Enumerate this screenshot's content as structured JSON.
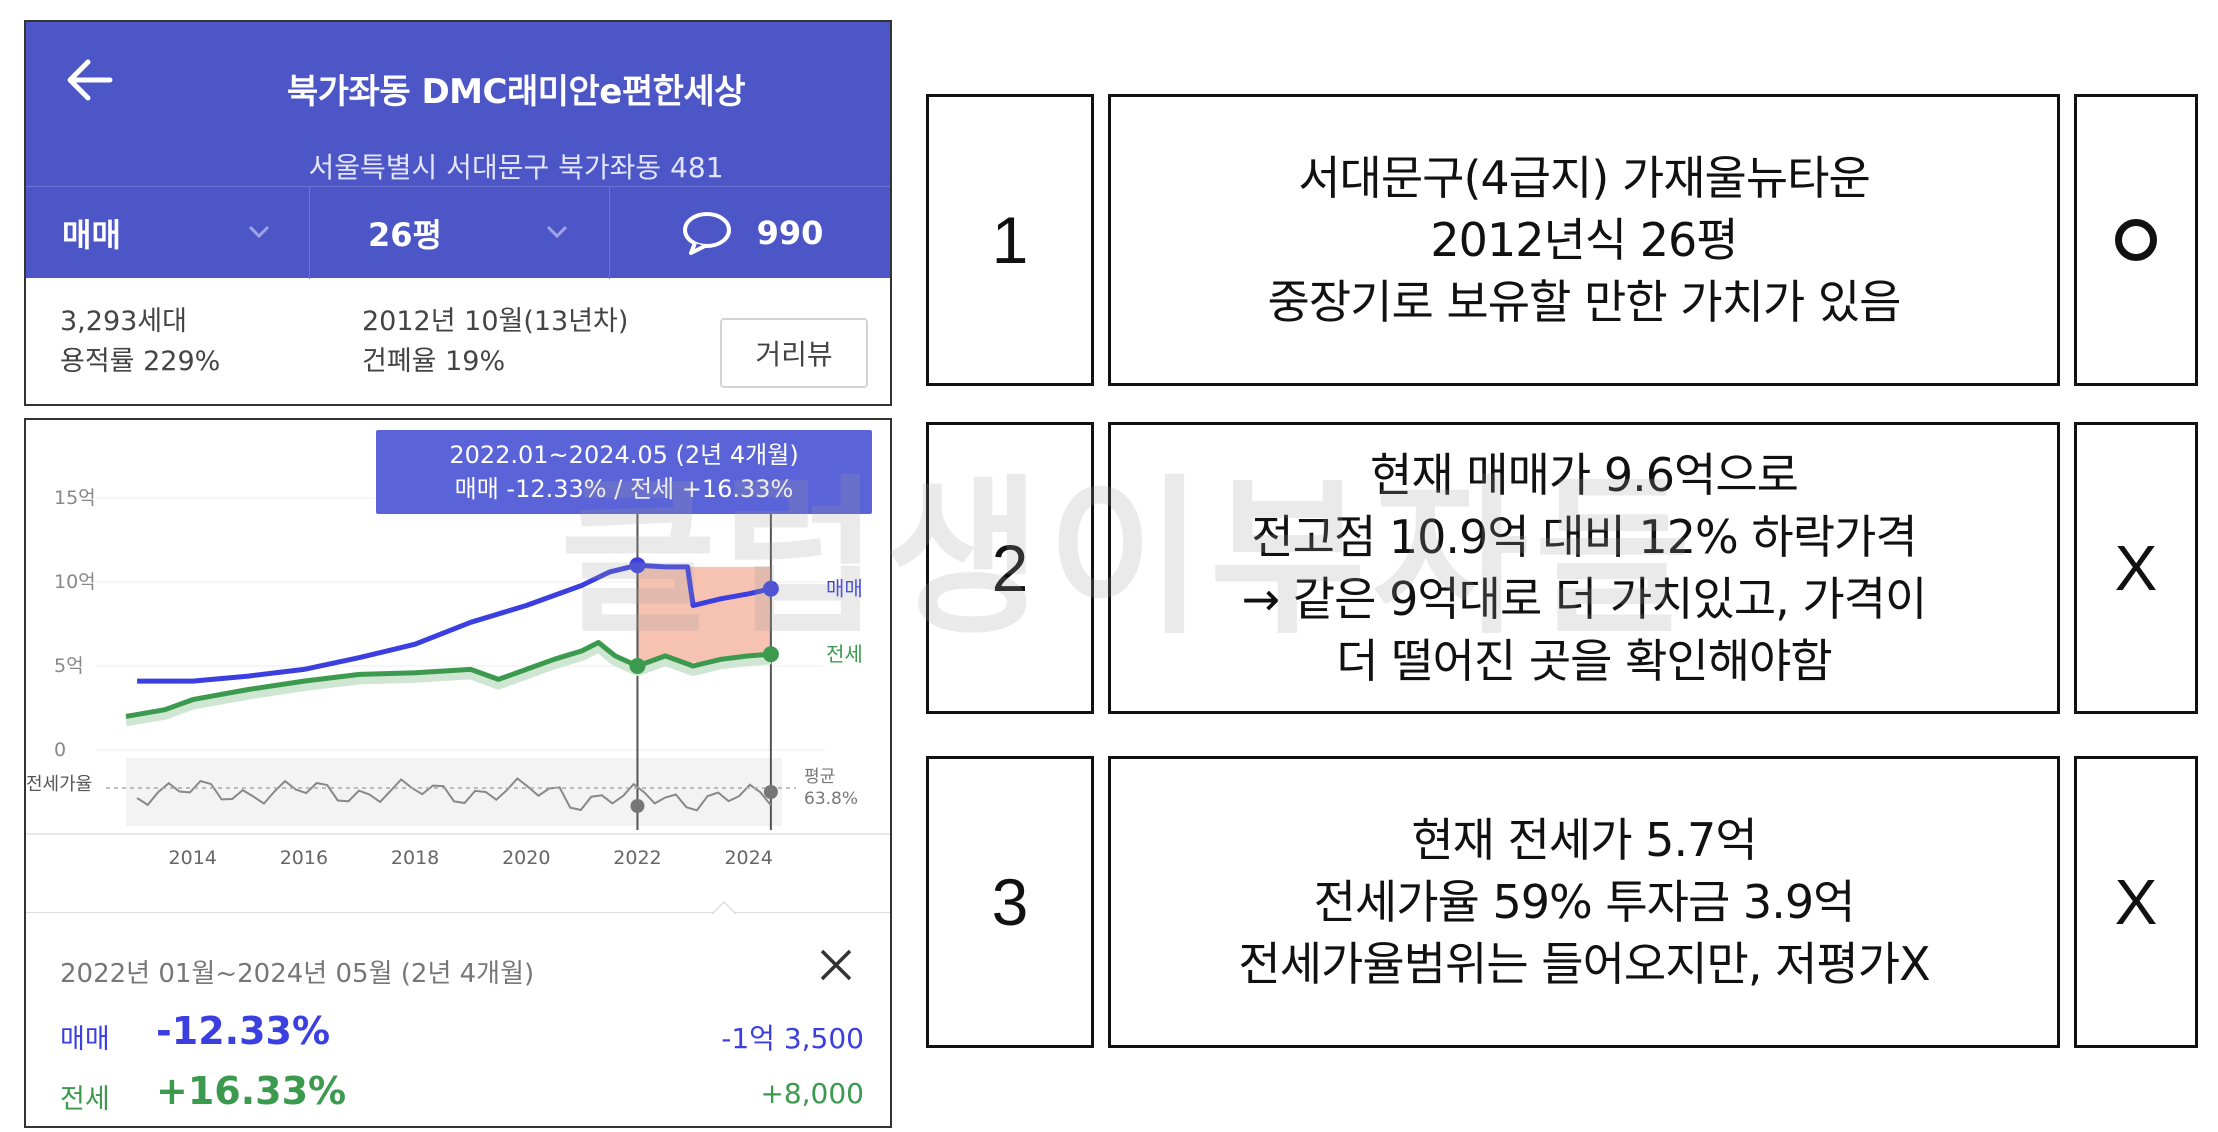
{
  "header": {
    "title": "북가좌동 DMC래미안e편한세상",
    "address": "서울특별시 서대문구 북가좌동 481",
    "trade_type": "매매",
    "size": "26평",
    "comment_count": "990"
  },
  "info": {
    "households": "3,293세대",
    "floor_area_ratio": "용적률 229%",
    "built": "2012년 10월(13년차)",
    "coverage_ratio": "건폐율 19%",
    "street_view_button": "거리뷰"
  },
  "chart": {
    "tooltip_line1": "2022.01~2024.05 (2년 4개월)",
    "tooltip_line2": "매매 -12.33%  /  전세 +16.33%",
    "y_ticks": [
      "15억",
      "10억",
      "5억",
      "0"
    ],
    "ratio_label": "전세가율",
    "avg_label": "평균",
    "avg_value": "63.8%",
    "x_ticks": [
      "2014",
      "2016",
      "2018",
      "2020",
      "2022",
      "2024"
    ],
    "series_sale_label": "매매",
    "series_jeonse_label": "전세",
    "colors": {
      "sale": "#3b3fe0",
      "jeonse": "#3b9a4e",
      "ratio": "#888888",
      "highlight": "#f5b9a4"
    }
  },
  "chart_data": {
    "type": "line",
    "xlabel": "",
    "ylabel": "",
    "ylim": [
      0,
      15
    ],
    "x_range": [
      2012.8,
      2024.6
    ],
    "series": [
      {
        "name": "매매",
        "points": [
          [
            2013.0,
            4.1
          ],
          [
            2014.0,
            4.1
          ],
          [
            2015.0,
            4.4
          ],
          [
            2016.0,
            4.8
          ],
          [
            2017.0,
            5.5
          ],
          [
            2018.0,
            6.3
          ],
          [
            2019.0,
            7.6
          ],
          [
            2020.0,
            8.6
          ],
          [
            2021.0,
            9.8
          ],
          [
            2021.5,
            10.6
          ],
          [
            2022.0,
            11.0
          ],
          [
            2022.5,
            10.9
          ],
          [
            2022.9,
            10.9
          ],
          [
            2023.0,
            8.6
          ],
          [
            2023.5,
            9.0
          ],
          [
            2024.0,
            9.3
          ],
          [
            2024.4,
            9.6
          ]
        ]
      },
      {
        "name": "전세",
        "points": [
          [
            2012.8,
            2.0
          ],
          [
            2013.5,
            2.4
          ],
          [
            2014.0,
            3.0
          ],
          [
            2015.0,
            3.6
          ],
          [
            2016.0,
            4.1
          ],
          [
            2017.0,
            4.5
          ],
          [
            2018.0,
            4.6
          ],
          [
            2019.0,
            4.8
          ],
          [
            2019.5,
            4.2
          ],
          [
            2020.0,
            4.8
          ],
          [
            2020.5,
            5.4
          ],
          [
            2021.0,
            5.9
          ],
          [
            2021.3,
            6.4
          ],
          [
            2021.6,
            5.6
          ],
          [
            2022.0,
            5.0
          ],
          [
            2022.5,
            5.6
          ],
          [
            2023.0,
            5.0
          ],
          [
            2023.5,
            5.4
          ],
          [
            2024.0,
            5.6
          ],
          [
            2024.4,
            5.7
          ]
        ]
      }
    ],
    "ratio_average_percent": 63.8
  },
  "summary": {
    "period": "2022년 01월~2024년 05월 (2년 4개월)",
    "sale_label": "매매",
    "sale_pct": "-12.33%",
    "sale_amount": "-1억 3,500",
    "jeonse_label": "전세",
    "jeonse_pct": "+16.33%",
    "jeonse_amount": "+8,000"
  },
  "table": {
    "rows": [
      {
        "num": "1",
        "lines": [
          "서대문구(4급지) 가재울뉴타운",
          "2012년식 26평",
          "중장기로 보유할 만한 가치가 있음"
        ],
        "mark": "O"
      },
      {
        "num": "2",
        "lines": [
          "현재 매매가 9.6억으로",
          "전고점 10.9억 대비 12% 하락가격",
          "→ 같은 9억대로 더 가치있고, 가격이",
          "더 떨어진 곳을 확인해야함"
        ],
        "mark": "X"
      },
      {
        "num": "3",
        "lines": [
          "현재 전세가 5.7억",
          "전세가율 59% 투자금 3.9억",
          "전세가율범위는 들어오지만, 저평가X"
        ],
        "mark": "X"
      }
    ]
  },
  "watermark": "클럽생이부자들"
}
